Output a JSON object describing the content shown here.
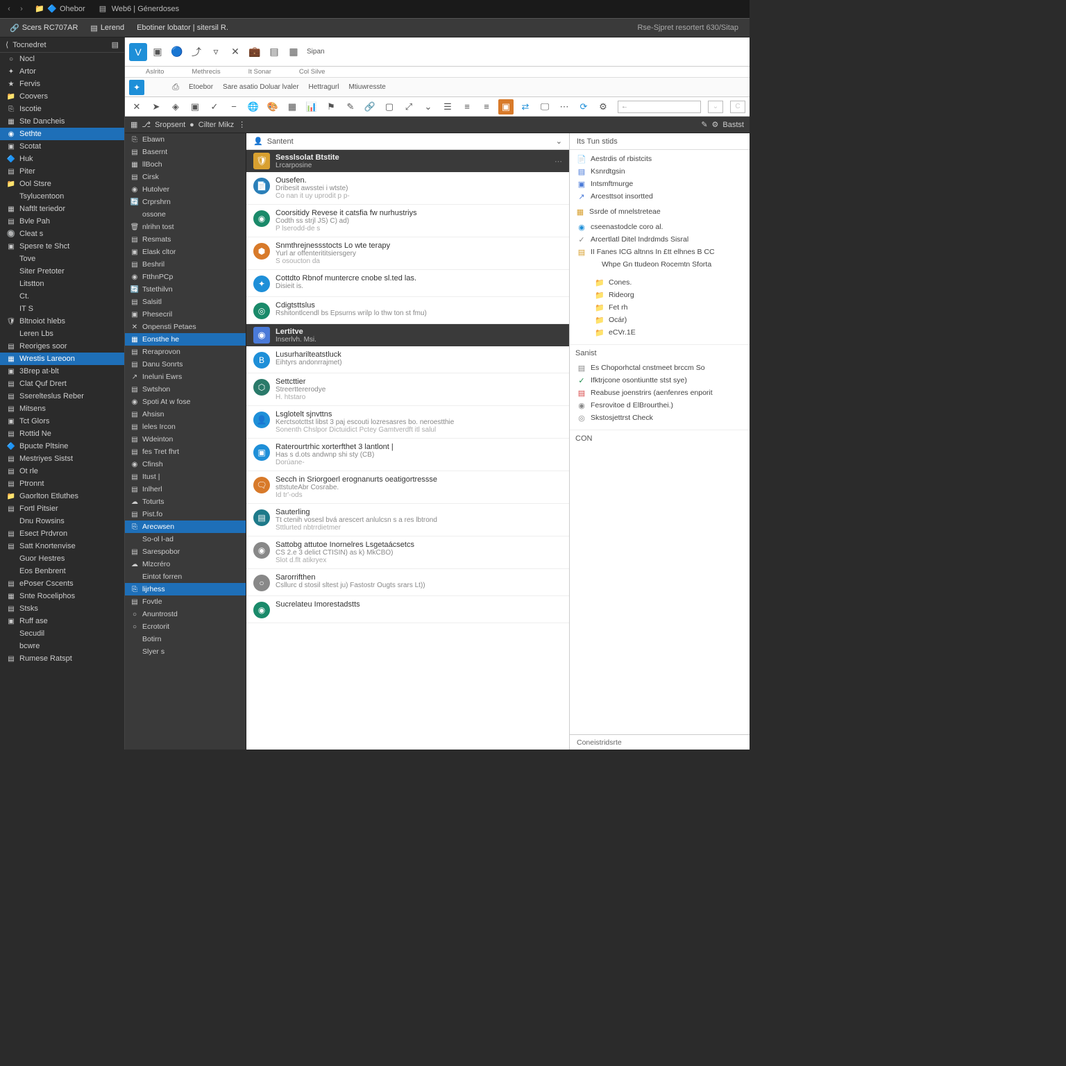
{
  "topbar": {
    "tabs": [
      {
        "label": "Ohebor"
      },
      {
        "label": "Web6 | Génerdoses"
      }
    ]
  },
  "menubar": {
    "items": [
      "Scers RC707AR",
      "Lerend",
      "Ebotiner lobator | sitersil R."
    ],
    "right": "Rse-Sjpret resortert 630/Sitap"
  },
  "leftnav_header": "Tocnedret",
  "leftnav": [
    {
      "icon": "○",
      "label": "Nocl"
    },
    {
      "icon": "✦",
      "label": "Artor"
    },
    {
      "icon": "★",
      "label": "Fervis"
    },
    {
      "icon": "📁",
      "label": "Coovers"
    },
    {
      "icon": "⎘",
      "label": "Iscotie"
    },
    {
      "icon": "▦",
      "label": "Ste Dancheis"
    },
    {
      "icon": "◉",
      "label": "Sethte",
      "sel": true
    },
    {
      "icon": "▣",
      "label": "Scotat"
    },
    {
      "icon": "🔷",
      "label": "Huk"
    },
    {
      "icon": "▤",
      "label": "Piter"
    },
    {
      "icon": "📁",
      "label": "Ool Stsre"
    },
    {
      "icon": " ",
      "label": "Tsylucentoon"
    },
    {
      "icon": "▦",
      "label": "Naftlt teriedor"
    },
    {
      "icon": "▤",
      "label": "Bvle Pah"
    },
    {
      "icon": "🔘",
      "label": "Cleat s"
    },
    {
      "icon": "▣",
      "label": "Spesre te Shct"
    },
    {
      "icon": " ",
      "label": "Tove"
    },
    {
      "icon": " ",
      "label": "Siter Pretoter"
    },
    {
      "icon": " ",
      "label": "Litstton"
    },
    {
      "icon": " ",
      "label": "Ct."
    },
    {
      "icon": " ",
      "label": "IT S"
    },
    {
      "icon": "🛡",
      "label": "Bltnoiot hlebs"
    },
    {
      "icon": " ",
      "label": "Leren Lbs"
    },
    {
      "icon": "▤",
      "label": "Reoriges soor"
    },
    {
      "icon": "▦",
      "label": "Wrestis Lareoon",
      "sel": true
    },
    {
      "icon": "▣",
      "label": "3Brep at-blt"
    },
    {
      "icon": "▤",
      "label": "Clat Quf Drert"
    },
    {
      "icon": "▤",
      "label": "Sserelteslus Reber"
    },
    {
      "icon": "▤",
      "label": "Mitsens"
    },
    {
      "icon": "▣",
      "label": "Tct Glors"
    },
    {
      "icon": "▤",
      "label": "Rottid Ne"
    },
    {
      "icon": "🔷",
      "label": "Bpucte Pltsine"
    },
    {
      "icon": "▤",
      "label": "Mestriyes Sistst"
    },
    {
      "icon": "▤",
      "label": "Ot rle"
    },
    {
      "icon": "▤",
      "label": "Ptronnt"
    },
    {
      "icon": "📁",
      "label": "Gaorlton Etluthes"
    },
    {
      "icon": "▤",
      "label": "Fortl Pitsier"
    },
    {
      "icon": " ",
      "label": "Dnu Rowsins"
    },
    {
      "icon": "▤",
      "label": "Esect Prdvron"
    },
    {
      "icon": "▤",
      "label": "Satt Knortenvise"
    },
    {
      "icon": " ",
      "label": "Guor Hestres"
    },
    {
      "icon": " ",
      "label": "Eos Benbrent"
    },
    {
      "icon": "▤",
      "label": "ePoser Cscents"
    },
    {
      "icon": "▦",
      "label": "Snte Roceliphos"
    },
    {
      "icon": "▤",
      "label": "Stsks"
    },
    {
      "icon": "▣",
      "label": "Ruff ase"
    },
    {
      "icon": " ",
      "label": "Secudil"
    },
    {
      "icon": " ",
      "label": "bcwre"
    },
    {
      "icon": "▤",
      "label": "Rumese Ratspt"
    }
  ],
  "apptool1": {
    "labels": [
      "Aslrito",
      "Methrecis",
      "It Sonar",
      "Col Silve"
    ],
    "span": "Sipan"
  },
  "apptool2": {
    "items": [
      "Etoebor",
      "Sare asatio Doluar lvaler",
      "Hettragurl",
      "Mtiuwresste"
    ]
  },
  "apptool3_search": "",
  "darkbar": {
    "left": "Sropsent",
    "mid": "Cilter Mikz",
    "right": "Bastst"
  },
  "tree": [
    {
      "icon": "⎘",
      "label": "Ebawn"
    },
    {
      "icon": "▤",
      "label": "Basernt"
    },
    {
      "icon": "▦",
      "label": "llBoch"
    },
    {
      "icon": "▤",
      "label": "Cirsk"
    },
    {
      "icon": "◉",
      "label": "Hutolver"
    },
    {
      "icon": "🔄",
      "label": "Crprshrn"
    },
    {
      "icon": " ",
      "label": "ossone"
    },
    {
      "icon": "🗑",
      "label": "nlrihn tost"
    },
    {
      "icon": "▤",
      "label": "Resmats"
    },
    {
      "icon": "▣",
      "label": "Elask cltor"
    },
    {
      "icon": "▤",
      "label": "Beshril"
    },
    {
      "icon": "◉",
      "label": "FtthnPCp"
    },
    {
      "icon": "🔄",
      "label": "Tstethilvn"
    },
    {
      "icon": "▤",
      "label": "Salsitl"
    },
    {
      "icon": "▣",
      "label": "Phesecril"
    },
    {
      "icon": "✕",
      "label": "Onpensti Petaes"
    },
    {
      "icon": "▦",
      "label": "Eonsthe he",
      "sel": true
    },
    {
      "icon": "▤",
      "label": "Reraprovon"
    },
    {
      "icon": "▤",
      "label": "Danu Sonrts"
    },
    {
      "icon": "↗",
      "label": "Ineluni Ewrs"
    },
    {
      "icon": "▤",
      "label": "Swtshon"
    },
    {
      "icon": "◉",
      "label": "Spoti At w fose"
    },
    {
      "icon": "▤",
      "label": "Ahsisn"
    },
    {
      "icon": "▤",
      "label": "leles Ircon"
    },
    {
      "icon": "▤",
      "label": "Wdeinton"
    },
    {
      "icon": "▤",
      "label": "fes Tret fhrt"
    },
    {
      "icon": "◉",
      "label": "Cfinsh"
    },
    {
      "icon": "▤",
      "label": "Itust |"
    },
    {
      "icon": "▤",
      "label": "Inlherl"
    },
    {
      "icon": "☁",
      "label": "Toturts"
    },
    {
      "icon": "▤",
      "label": "Pist.fo"
    },
    {
      "icon": "⎘",
      "label": "Arecwsen",
      "sel": true
    },
    {
      "icon": " ",
      "label": "So-ol l-ad"
    },
    {
      "icon": "▤",
      "label": "Sarespobor"
    },
    {
      "icon": "☁",
      "label": "Mlzcréro"
    },
    {
      "icon": " ",
      "label": "Eintot forren"
    },
    {
      "icon": "⎘",
      "label": "lijrhess",
      "sel": true
    },
    {
      "icon": "▤",
      "label": "Fovtle"
    },
    {
      "icon": "○",
      "label": "Anuntrostd"
    },
    {
      "icon": "○",
      "label": "Ecrotorit"
    },
    {
      "icon": " ",
      "label": "Botirn"
    },
    {
      "icon": " ",
      "label": "Slyer s"
    }
  ],
  "center_header": "Santent",
  "section1": {
    "title": "Sesslsolat Btstite",
    "sub": "Lrcarposine"
  },
  "feed1": [
    {
      "color": "#2b7fb8",
      "icon": "📄",
      "t1": "Ousefen.",
      "t2": "Dribesit awsstei i wtste)",
      "t3": "Co nan it uy uprodit p p-"
    },
    {
      "color": "#1a8a6a",
      "icon": "◉",
      "t1": "Coorsitidy Revese it catsfia fw nurhustriys",
      "t2": "Codth ss strjl JS) C) ad)",
      "t3": "P lserodd-de s"
    },
    {
      "color": "#d87a2a",
      "icon": "⬢",
      "t1": "Snmthrejnessstocts Lo wte terapy",
      "t2": "Yurl ar offenterititsiersgery",
      "t3": "S osoucton da"
    },
    {
      "color": "#1e8fd8",
      "icon": "✦",
      "t1": "Cottdto Rbnof muntercre cnobe sl.ted las.",
      "t2": "Disieit is."
    },
    {
      "color": "#1a8a6a",
      "icon": "◎",
      "t1": "Cdigtsttslus",
      "t2": "Rshitontlcendl bs Epsurns wrilp lo thw ton st fmu)"
    }
  ],
  "section2": {
    "title": "Lertitve",
    "sub": "Inserlvh. Msi."
  },
  "feed2": [
    {
      "color": "#1e8fd8",
      "icon": "B",
      "t1": "Lusurharilteatstluck",
      "t2": "Eihtyrs andonrrajmet)"
    },
    {
      "color": "#2a7a6a",
      "icon": "⬡",
      "t1": "Settcttier",
      "t2": "Streerttererodye",
      "t3": "H. htstaro"
    },
    {
      "color": "#1e8fd8",
      "icon": "👤",
      "t1": "Lsglotelt sjnvttns",
      "t2": "Kerctsotcttst libst 3 paj escouti lozresasres bo. neroestthie",
      "t3": "Sonenth Chslpor Dictuidict Pctey Gamtverdft itl salul"
    },
    {
      "color": "#1e8fd8",
      "icon": "▣",
      "t1": "Raterourtrhic xorterfthet 3 lantlont |",
      "t2": "Has s d.ots andwnp shi sty (CB)",
      "t3": "Dorúane-"
    },
    {
      "color": "#d87a2a",
      "icon": "🗨",
      "t1": "Secch in Sriorgoerl erognanurts oeatigortressse",
      "t2": "sttstuteAbr Cosrabe.",
      "t3": "Id tr'-ods"
    },
    {
      "color": "#1e7a8a",
      "icon": "▤",
      "t1": "Sauterling",
      "t2": "Tt ctenih vosesl bvá arescert anlulcsn s a res lbtrond",
      "t3": "Sttlurted nbtrrdietmer"
    },
    {
      "color": "#888",
      "icon": "◉",
      "t1": "Sattobg attutoe Inornelres Lsgetaácsetcs",
      "t2": "CS 2.e 3 delict CTISIN) as k) MkCBO)",
      "t3": "Slot d.flt atikryex"
    },
    {
      "color": "#888",
      "icon": "○",
      "t1": "Sarorrifthen",
      "t2": "Csllurc d stosil sltest ju) Fastostr Ougts srars Lt))"
    },
    {
      "color": "#1a8a6a",
      "icon": "◉",
      "t1": "Sucrelateu Imorestadstts"
    }
  ],
  "inspector": {
    "header": "Its Tun stids",
    "group1": [
      {
        "icon": "📄",
        "c": "#d8a030",
        "label": "Aestrdis of rbistcits"
      },
      {
        "icon": "▤",
        "c": "#4a7ad8",
        "label": "Ksnrdtgsin"
      },
      {
        "icon": "▣",
        "c": "#4a7ad8",
        "label": "Intsmftmurge"
      },
      {
        "icon": "↗",
        "c": "#4a7ad8",
        "label": "Arcesttsot insortted"
      }
    ],
    "group2_title": "Ssrde of mnelstreteae",
    "group2": [
      {
        "icon": "◉",
        "c": "#1e8fd8",
        "label": "cseenastodcle coro al."
      },
      {
        "icon": "✓",
        "c": "#888",
        "label": "Arcertlatl Ditel Indrdmds Sisral"
      },
      {
        "icon": "▤",
        "c": "#d8a030",
        "label": "II Fanes ICG altnns In £tt elhnes B CC"
      },
      {
        "icon": " ",
        "c": "",
        "label": "Whpe Gn ttudeon Rocemtn Sforta",
        "sub": true
      }
    ],
    "group2_sub": [
      {
        "icon": "📁",
        "c": "#d8a030",
        "label": "Cones."
      },
      {
        "icon": "📁",
        "c": "#d8a030",
        "label": "Rideorg"
      },
      {
        "icon": "📁",
        "c": "#d8a030",
        "label": "Fet rh"
      },
      {
        "icon": "📁",
        "c": "#d8a030",
        "label": "Ocár)"
      },
      {
        "icon": "📁",
        "c": "#d8a030",
        "label": "eCVr.1E"
      }
    ],
    "sanist": "Sanist",
    "group3": [
      {
        "icon": "▤",
        "c": "#888",
        "label": "Es Choporhctal cnstmeet brccm So"
      },
      {
        "icon": "✓",
        "c": "#1a8a4a",
        "label": "Ifktrjcone osontiuntte stst sye)"
      },
      {
        "icon": "▤",
        "c": "#d84a4a",
        "label": "Reabuse joenstrirs (aenfenres enporit"
      },
      {
        "icon": "◉",
        "c": "#888",
        "label": "Fesrovitoe d ElBrourthei.)"
      },
      {
        "icon": "◎",
        "c": "#888",
        "label": "Skstosjettrst Check"
      }
    ],
    "con": "CON",
    "footer": "Coneistridsrte"
  }
}
